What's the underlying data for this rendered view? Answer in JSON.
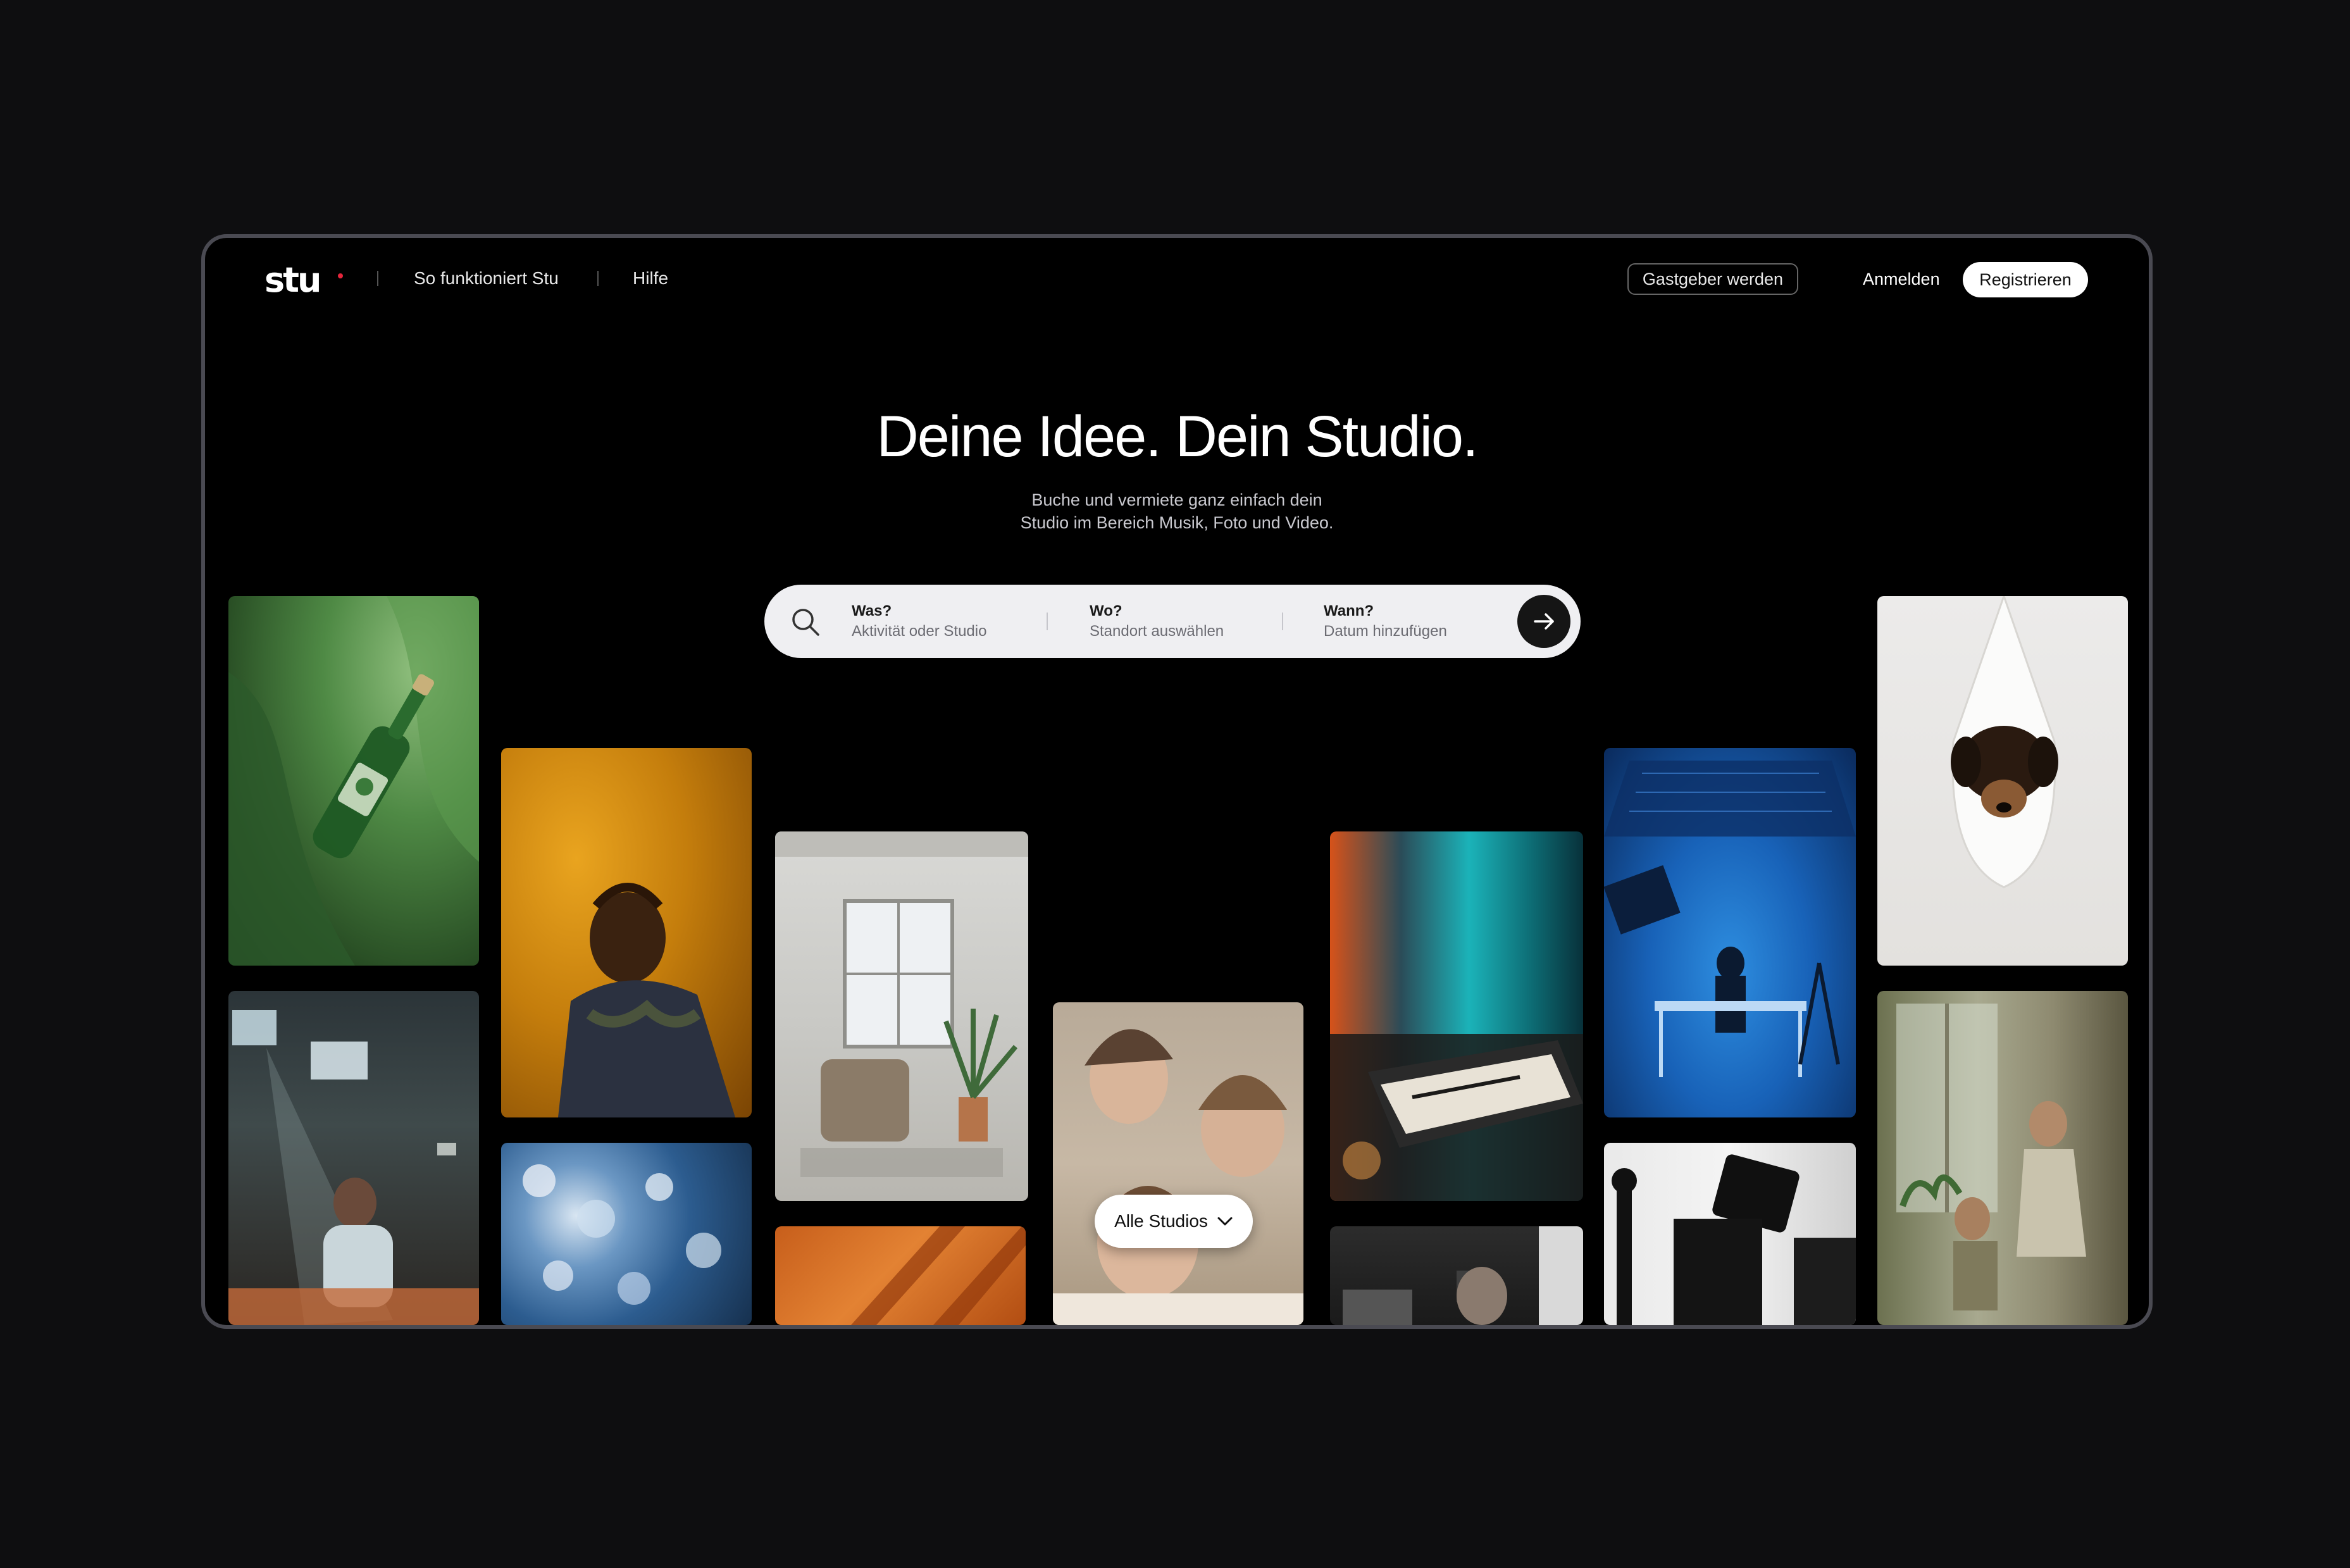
{
  "header": {
    "logo": "stu",
    "nav": [
      {
        "label": "So funktioniert Stu"
      },
      {
        "label": "Hilfe"
      }
    ],
    "host_button": "Gastgeber werden",
    "login": "Anmelden",
    "register": "Registrieren"
  },
  "hero": {
    "title": "Deine Idee. Dein Studio.",
    "subtitle_line1": "Buche und vermiete ganz einfach dein",
    "subtitle_line2": "Studio im Bereich Musik, Foto und Video."
  },
  "search": {
    "fields": [
      {
        "label": "Was?",
        "placeholder": "Aktivität oder Studio"
      },
      {
        "label": "Wo?",
        "placeholder": "Standort auswählen"
      },
      {
        "label": "Wann?",
        "placeholder": "Datum hinzufügen"
      }
    ]
  },
  "gallery": {
    "filter_label": "Alle Studios",
    "tiles": [
      {
        "name": "bottle-photo"
      },
      {
        "name": "woman-set-photo"
      },
      {
        "name": "man-orange-photo"
      },
      {
        "name": "blue-flowers-photo"
      },
      {
        "name": "armchair-room-photo"
      },
      {
        "name": "orange-shadow-photo"
      },
      {
        "name": "women-portrait-photo"
      },
      {
        "name": "music-keyboard-photo"
      },
      {
        "name": "recording-desk-photo"
      },
      {
        "name": "blue-studio-dj-photo"
      },
      {
        "name": "film-camera-photo"
      },
      {
        "name": "dog-hammock-photo"
      },
      {
        "name": "women-window-photo"
      }
    ]
  },
  "colors": {
    "background": "#0e0e10",
    "frame_border": "#4a4a52",
    "logo_accent": "#e5253b",
    "search_bg": "#efeff2"
  }
}
